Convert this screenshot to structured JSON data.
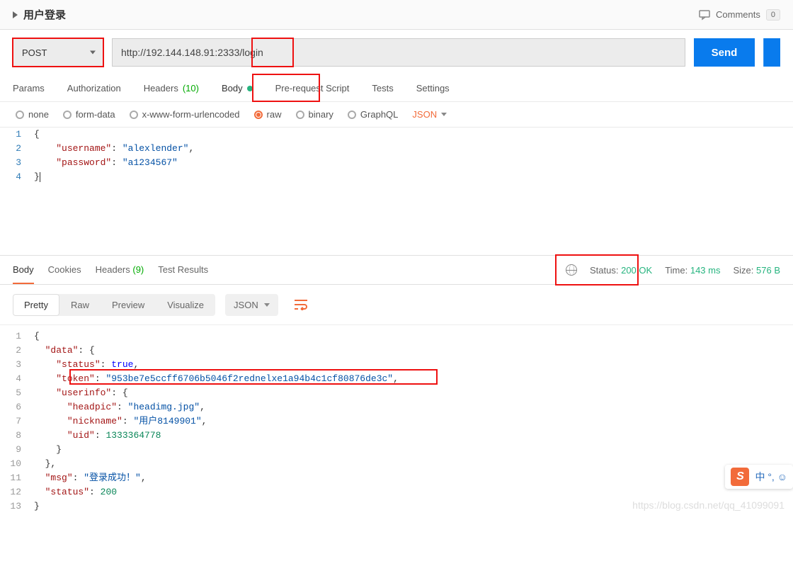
{
  "header": {
    "title": "用户登录",
    "comments_label": "Comments",
    "comments_count": "0"
  },
  "request": {
    "method": "POST",
    "url": "http://192.144.148.91:2333/login",
    "send_label": "Send"
  },
  "req_tabs": {
    "params": "Params",
    "authorization": "Authorization",
    "headers": "Headers",
    "headers_count": "(10)",
    "body": "Body",
    "prerequest": "Pre-request Script",
    "tests": "Tests",
    "settings": "Settings"
  },
  "body_types": {
    "none": "none",
    "formdata": "form-data",
    "xwww": "x-www-form-urlencoded",
    "raw": "raw",
    "binary": "binary",
    "graphql": "GraphQL",
    "content_type": "JSON"
  },
  "request_body": {
    "line1": "{",
    "line2_key": "\"username\"",
    "line2_val": "\"alexlender\"",
    "line3_key": "\"password\"",
    "line3_val": "\"a1234567\"",
    "line4": "}"
  },
  "resp_tabs": {
    "body": "Body",
    "cookies": "Cookies",
    "headers": "Headers",
    "headers_count": "(9)",
    "tests": "Test Results"
  },
  "resp_meta": {
    "status_label": "Status:",
    "status_value": "200 OK",
    "time_label": "Time:",
    "time_value": "143 ms",
    "size_label": "Size:",
    "size_value": "576 B"
  },
  "view": {
    "pretty": "Pretty",
    "raw": "Raw",
    "preview": "Preview",
    "visualize": "Visualize",
    "json": "JSON"
  },
  "response_body": {
    "l1": "{",
    "l2_key": "\"data\"",
    "l2_v": "{",
    "l3_key": "\"status\"",
    "l3_v": "true",
    "l4_key": "\"token\"",
    "l4_v": "\"953be7e5ccff6706b5046f2rednelxe1a94b4c1cf80876de3c\"",
    "l5_key": "\"userinfo\"",
    "l5_v": "{",
    "l6_key": "\"headpic\"",
    "l6_v": "\"headimg.jpg\"",
    "l7_key": "\"nickname\"",
    "l7_v": "\"用户8149901\"",
    "l8_key": "\"uid\"",
    "l8_v": "1333364778",
    "l9": "}",
    "l10": "},",
    "l11_key": "\"msg\"",
    "l11_v": "\"登录成功！\"",
    "l12_key": "\"status\"",
    "l12_v": "200",
    "l13": "}"
  },
  "watermark": "https://blog.csdn.net/qq_41099091",
  "ime": "中 °, ☺"
}
